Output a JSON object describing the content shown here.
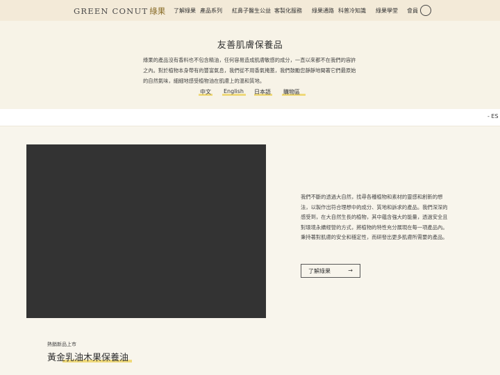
{
  "header": {
    "logo_text": "GREEN CONUT",
    "logo_cn": "綠果",
    "nav": [
      {
        "label": "了解綠果"
      },
      {
        "label": "產品系列"
      },
      {
        "label": "紅鼻子醫生公益"
      },
      {
        "label": "客製化服務"
      },
      {
        "label": "綠果通路"
      },
      {
        "label": "科普冷知識"
      },
      {
        "label": "綠果學堂"
      },
      {
        "label": "會員"
      }
    ],
    "member_icon": "user-circle-icon"
  },
  "intro": {
    "title": "友善肌膚保養品",
    "text": "綠果的產品沒有香料也不包含精油，任何容易造成肌膚敏感的成分，一直以來都不在我們的容許之內。對於植物本身帶有的豐富氣息，我們從不用香氣掩蓋，我們鼓勵您靜靜地聞著它們最原始的自然氣味，細細地感受植物油在肌膚上的溫和質地。",
    "languages": [
      {
        "label": "中文"
      },
      {
        "label": "English"
      },
      {
        "label": "日本語"
      },
      {
        "label": "購物區"
      }
    ]
  },
  "strip": {
    "text": "-  ES"
  },
  "about": {
    "text": "我們不斷的透過大自然，找尋各種植物和素材的靈感和創新的想法，以製作出符合理想中的成分、質地和訴求的產品。我們深深的感受到，在大自然生長的植物，其中蘊含強大的能量，透過安全且對環境永續經營的方式，將植物的特性充分展現在每一項產品內。秉持著對肌膚的安全和穩定性，而研發出更多肌膚所需要的產品。",
    "button_label": "了解綠果",
    "button_arrow": "→"
  },
  "product": {
    "label": "熱銷新品上市",
    "title": "黃金乳油木果保養油"
  },
  "colors": {
    "header_bg": "#f3ead8",
    "accent_yellow": "#efd97a",
    "video_bg": "#333333",
    "page_bg": "#f8f5ec"
  }
}
